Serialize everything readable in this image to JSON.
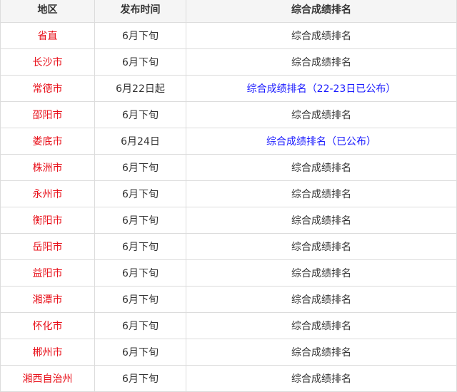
{
  "headers": [
    "地区",
    "发布时间",
    "综合成绩排名"
  ],
  "rows": [
    {
      "region": "省直",
      "time": "6月下旬",
      "ranking": "综合成绩排名",
      "ranking_is_link": false
    },
    {
      "region": "长沙市",
      "time": "6月下旬",
      "ranking": "综合成绩排名",
      "ranking_is_link": false
    },
    {
      "region": "常德市",
      "time": "6月22日起",
      "ranking": "综合成绩排名（22-23日已公布）",
      "ranking_is_link": true
    },
    {
      "region": "邵阳市",
      "time": "6月下旬",
      "ranking": "综合成绩排名",
      "ranking_is_link": false
    },
    {
      "region": "娄底市",
      "time": "6月24日",
      "ranking": "综合成绩排名（已公布）",
      "ranking_is_link": true
    },
    {
      "region": "株洲市",
      "time": "6月下旬",
      "ranking": "综合成绩排名",
      "ranking_is_link": false
    },
    {
      "region": "永州市",
      "time": "6月下旬",
      "ranking": "综合成绩排名",
      "ranking_is_link": false
    },
    {
      "region": "衡阳市",
      "time": "6月下旬",
      "ranking": "综合成绩排名",
      "ranking_is_link": false
    },
    {
      "region": "岳阳市",
      "time": "6月下旬",
      "ranking": "综合成绩排名",
      "ranking_is_link": false
    },
    {
      "region": "益阳市",
      "time": "6月下旬",
      "ranking": "综合成绩排名",
      "ranking_is_link": false
    },
    {
      "region": "湘潭市",
      "time": "6月下旬",
      "ranking": "综合成绩排名",
      "ranking_is_link": false
    },
    {
      "region": "怀化市",
      "time": "6月下旬",
      "ranking": "综合成绩排名",
      "ranking_is_link": false
    },
    {
      "region": "郴州市",
      "time": "6月下旬",
      "ranking": "综合成绩排名",
      "ranking_is_link": false
    },
    {
      "region": "湘西自治州",
      "time": "6月下旬",
      "ranking": "综合成绩排名",
      "ranking_is_link": false
    }
  ],
  "colors": {
    "region_text": "#e8101a",
    "link_text": "#1a1aff",
    "plain_text": "#333333",
    "header_bg": "#f5f5f5",
    "border": "#dcdcdc"
  }
}
